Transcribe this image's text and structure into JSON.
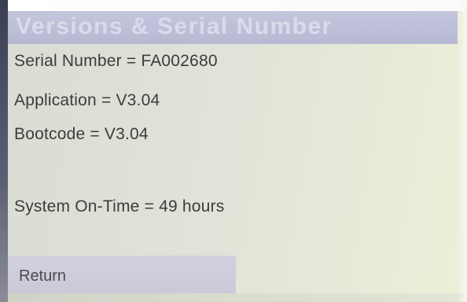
{
  "screen": {
    "title": "Versions & Serial Number",
    "serial_number_line": "Serial Number = FA002680",
    "application_line": "Application = V3.04",
    "bootcode_line": "Bootcode = V3.04",
    "on_time_line": "System On-Time = 49 hours",
    "return_label": "Return"
  },
  "colors": {
    "title_bar": "#b9bbd5",
    "title_text": "#dadbea",
    "background": "#dee2d8",
    "text": "#3c3d3a",
    "return_button": "#cecbdb"
  }
}
